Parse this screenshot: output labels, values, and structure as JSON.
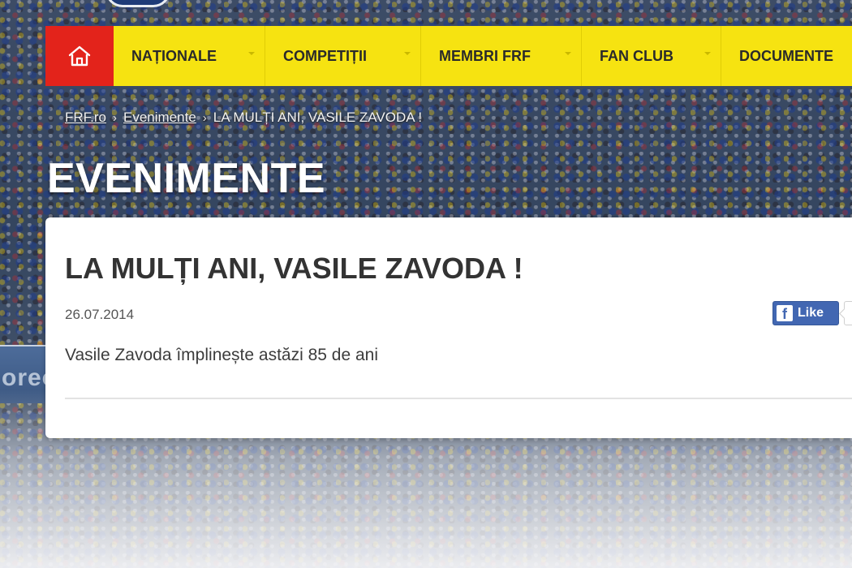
{
  "colors": {
    "nav_background": "#f6e311",
    "home_button": "#e3231b",
    "facebook_blue": "#4267b2"
  },
  "navbar": {
    "home_icon": "home-icon",
    "items": [
      {
        "label": "NAȚIONALE"
      },
      {
        "label": "COMPETIȚII"
      },
      {
        "label": "MEMBRI FRF"
      },
      {
        "label": "FAN CLUB"
      },
      {
        "label": "DOCUMENTE"
      }
    ]
  },
  "breadcrumb": {
    "items": [
      "FRF.ro",
      "Evenimente",
      "LA MULȚI ANI, VASILE ZAVODA !"
    ],
    "separator": "›"
  },
  "section": {
    "title": "EVENIMENTE"
  },
  "article": {
    "title": "LA MULȚI ANI, VASILE ZAVODA !",
    "date": "26.07.2014",
    "lead": "Vasile Zavoda împlinește astăzi 85 de ani",
    "like_label": "Like",
    "like_icon": "facebook-icon"
  },
  "background": {
    "banner_text": "oreo"
  }
}
